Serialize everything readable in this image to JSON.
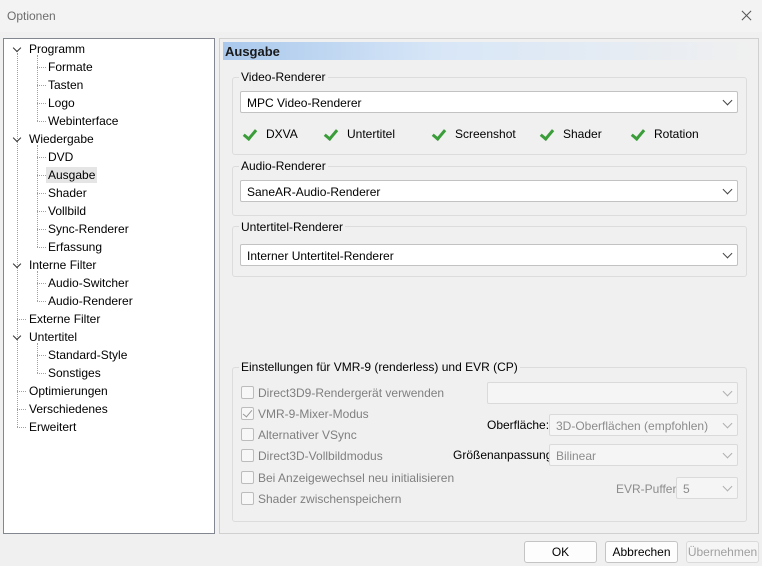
{
  "window": {
    "title": "Optionen"
  },
  "tree": {
    "items": [
      {
        "label": "Programm",
        "level": 0
      },
      {
        "label": "Formate",
        "level": 1
      },
      {
        "label": "Tasten",
        "level": 1
      },
      {
        "label": "Logo",
        "level": 1
      },
      {
        "label": "Webinterface",
        "level": 1
      },
      {
        "label": "Wiedergabe",
        "level": 0
      },
      {
        "label": "DVD",
        "level": 1
      },
      {
        "label": "Ausgabe",
        "level": 1,
        "selected": true
      },
      {
        "label": "Shader",
        "level": 1
      },
      {
        "label": "Vollbild",
        "level": 1
      },
      {
        "label": "Sync-Renderer",
        "level": 1
      },
      {
        "label": "Erfassung",
        "level": 1
      },
      {
        "label": "Interne Filter",
        "level": 0
      },
      {
        "label": "Audio-Switcher",
        "level": 1
      },
      {
        "label": "Audio-Renderer",
        "level": 1
      },
      {
        "label": "Externe Filter",
        "level": 0
      },
      {
        "label": "Untertitel",
        "level": 0
      },
      {
        "label": "Standard-Style",
        "level": 1
      },
      {
        "label": "Sonstiges",
        "level": 1
      },
      {
        "label": "Optimierungen",
        "level": 0
      },
      {
        "label": "Verschiedenes",
        "level": 0
      },
      {
        "label": "Erweitert",
        "level": 0
      }
    ]
  },
  "page": {
    "header": "Ausgabe"
  },
  "video": {
    "group_label": "Video-Renderer",
    "renderer": "MPC Video-Renderer",
    "capabilities": [
      "DXVA",
      "Untertitel",
      "Screenshot",
      "Shader",
      "Rotation"
    ]
  },
  "audio": {
    "group_label": "Audio-Renderer",
    "renderer": "SaneAR-Audio-Renderer"
  },
  "subtitle": {
    "group_label": "Untertitel-Renderer",
    "renderer": "Interner Untertitel-Renderer"
  },
  "vmr": {
    "group_label": "Einstellungen für VMR-9 (renderless) und EVR (CP)",
    "checkboxes": [
      {
        "label": "Direct3D9-Rendergerät verwenden",
        "checked": false
      },
      {
        "label": "VMR-9-Mixer-Modus",
        "checked": true
      },
      {
        "label": "Alternativer VSync",
        "checked": false
      },
      {
        "label": "Direct3D-Vollbildmodus",
        "checked": false
      },
      {
        "label": "Bei Anzeigewechsel neu initialisieren",
        "checked": false
      },
      {
        "label": "Shader zwischenspeichern",
        "checked": false
      }
    ],
    "device_value": "",
    "surface_label": "Oberfläche:",
    "surface_value": "3D-Oberflächen (empfohlen)",
    "resize_label": "Größenanpassung:",
    "resize_value": "Bilinear",
    "evr_label": "EVR-Puffer:",
    "evr_value": "5"
  },
  "buttons": {
    "ok": "OK",
    "cancel": "Abbrechen",
    "apply": "Übernehmen"
  },
  "colors": {
    "check_green": "#3a9d3a",
    "header_blue": "#a9c8ec"
  }
}
